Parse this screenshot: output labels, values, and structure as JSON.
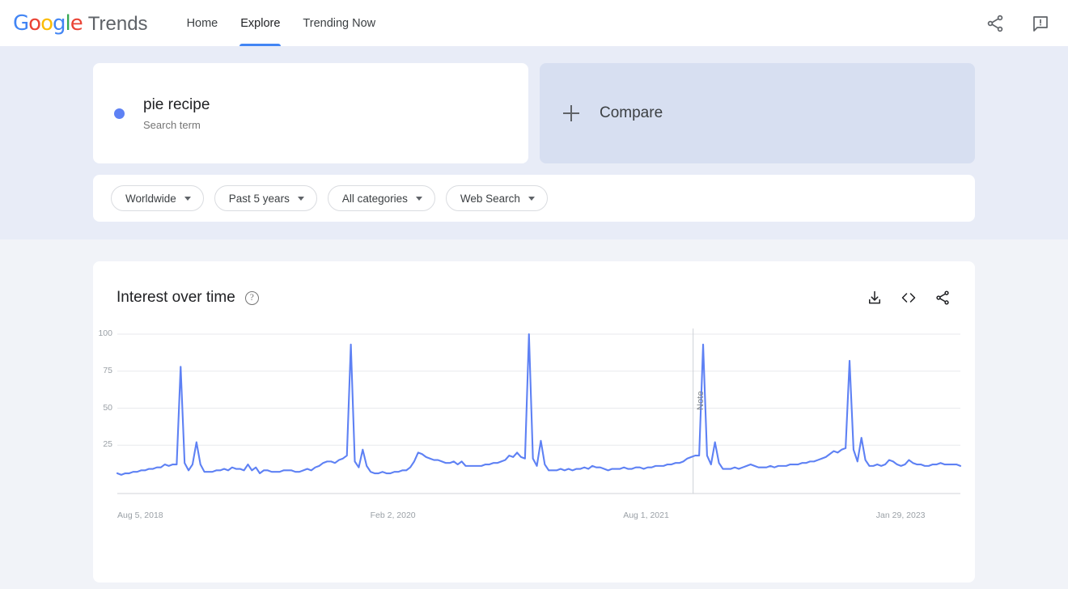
{
  "header": {
    "logo_parts": [
      "G",
      "o",
      "o",
      "g",
      "l",
      "e"
    ],
    "product": "Trends",
    "nav": [
      {
        "label": "Home",
        "active": false
      },
      {
        "label": "Explore",
        "active": true
      },
      {
        "label": "Trending Now",
        "active": false
      }
    ],
    "share_icon": "share-icon",
    "feedback_icon": "feedback-icon"
  },
  "search": {
    "term": "pie recipe",
    "type_label": "Search term",
    "dot_color": "#5E81F4",
    "compare_label": "Compare",
    "compare_icon": "plus-icon"
  },
  "filters": [
    {
      "label": "Worldwide",
      "name": "location-filter"
    },
    {
      "label": "Past 5 years",
      "name": "time-range-filter"
    },
    {
      "label": "All categories",
      "name": "category-filter"
    },
    {
      "label": "Web Search",
      "name": "search-type-filter"
    }
  ],
  "chart_card": {
    "title": "Interest over time",
    "help_glyph": "?",
    "tools": [
      {
        "name": "download-icon"
      },
      {
        "name": "embed-code-icon"
      },
      {
        "name": "share-icon"
      }
    ]
  },
  "chart_data": {
    "type": "line",
    "title": "Interest over time",
    "xlabel": "",
    "ylabel": "",
    "ylim": [
      0,
      100
    ],
    "yticks": [
      100,
      75,
      50,
      25
    ],
    "grid": true,
    "legend": false,
    "line_color": "#5E81F4",
    "xtick_labels": [
      "Aug 5, 2018",
      "Feb 2, 2020",
      "Aug 1, 2021",
      "Jan 29, 2023"
    ],
    "xtick_positions": [
      0.0,
      0.3,
      0.6,
      0.9
    ],
    "annotations": [
      {
        "label": "Note",
        "x_fraction": 0.683,
        "type": "vertical-line"
      }
    ],
    "series": [
      {
        "name": "pie recipe",
        "values": [
          6,
          5,
          6,
          6,
          7,
          7,
          8,
          8,
          9,
          9,
          10,
          10,
          12,
          11,
          12,
          12,
          78,
          13,
          8,
          12,
          27,
          12,
          7,
          7,
          7,
          8,
          8,
          9,
          8,
          10,
          9,
          9,
          8,
          12,
          8,
          10,
          6,
          8,
          8,
          7,
          7,
          7,
          8,
          8,
          8,
          7,
          7,
          8,
          9,
          8,
          10,
          11,
          13,
          14,
          14,
          13,
          15,
          16,
          18,
          93,
          14,
          10,
          22,
          11,
          7,
          6,
          6,
          7,
          6,
          6,
          7,
          7,
          8,
          8,
          10,
          14,
          20,
          19,
          17,
          16,
          15,
          15,
          14,
          13,
          13,
          14,
          12,
          14,
          11,
          11,
          11,
          11,
          11,
          12,
          12,
          13,
          13,
          14,
          15,
          18,
          17,
          20,
          17,
          16,
          100,
          16,
          11,
          28,
          12,
          8,
          8,
          8,
          9,
          8,
          9,
          8,
          9,
          9,
          10,
          9,
          11,
          10,
          10,
          9,
          8,
          9,
          9,
          9,
          10,
          9,
          9,
          10,
          10,
          9,
          10,
          10,
          11,
          11,
          11,
          12,
          12,
          13,
          13,
          14,
          16,
          17,
          18,
          18,
          93,
          18,
          12,
          27,
          13,
          9,
          9,
          9,
          10,
          9,
          10,
          11,
          12,
          11,
          10,
          10,
          10,
          11,
          10,
          11,
          11,
          11,
          12,
          12,
          12,
          13,
          13,
          14,
          14,
          15,
          16,
          17,
          19,
          21,
          20,
          22,
          23,
          82,
          22,
          14,
          30,
          15,
          11,
          11,
          12,
          11,
          12,
          15,
          14,
          12,
          11,
          12,
          15,
          13,
          12,
          12,
          11,
          11,
          12,
          12,
          13,
          12,
          12,
          12,
          12,
          11
        ]
      }
    ]
  }
}
